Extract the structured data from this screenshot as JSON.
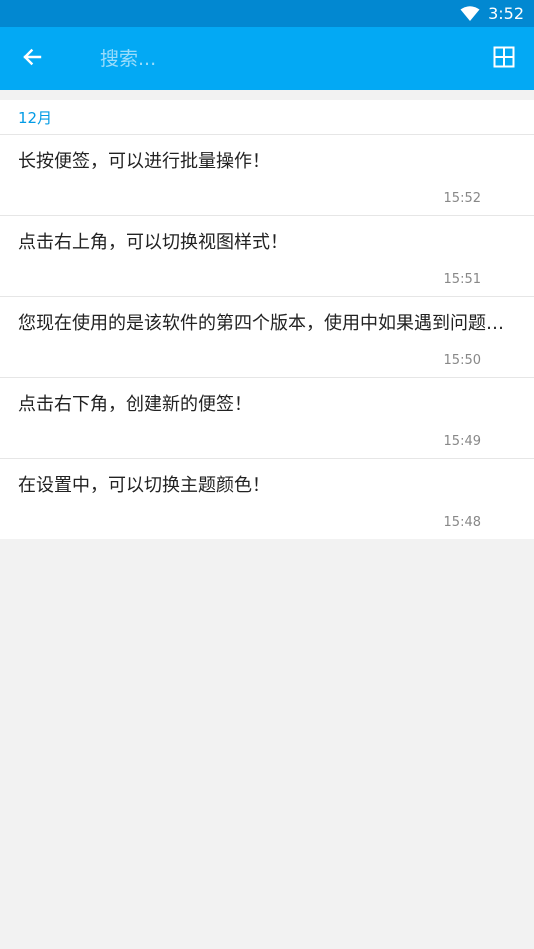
{
  "status_bar": {
    "time": "3:52",
    "wifi_icon": "wifi-icon"
  },
  "app_bar": {
    "back_icon": "arrow-back-icon",
    "search_placeholder": "搜索...",
    "view_toggle_icon": "grid-view-icon",
    "accent_color": "#03a9f4"
  },
  "list": {
    "section_header": "12月",
    "notes": [
      {
        "text": "长按便签，可以进行批量操作！",
        "time": "15:52"
      },
      {
        "text": "点击右上角，可以切换视图样式！",
        "time": "15:51"
      },
      {
        "text": "您现在使用的是该软件的第四个版本，使用中如果遇到问题，请及时反馈！",
        "time": "15:50"
      },
      {
        "text": "点击右下角，创建新的便签！",
        "time": "15:49"
      },
      {
        "text": "在设置中，可以切换主题颜色！",
        "time": "15:48"
      }
    ]
  }
}
